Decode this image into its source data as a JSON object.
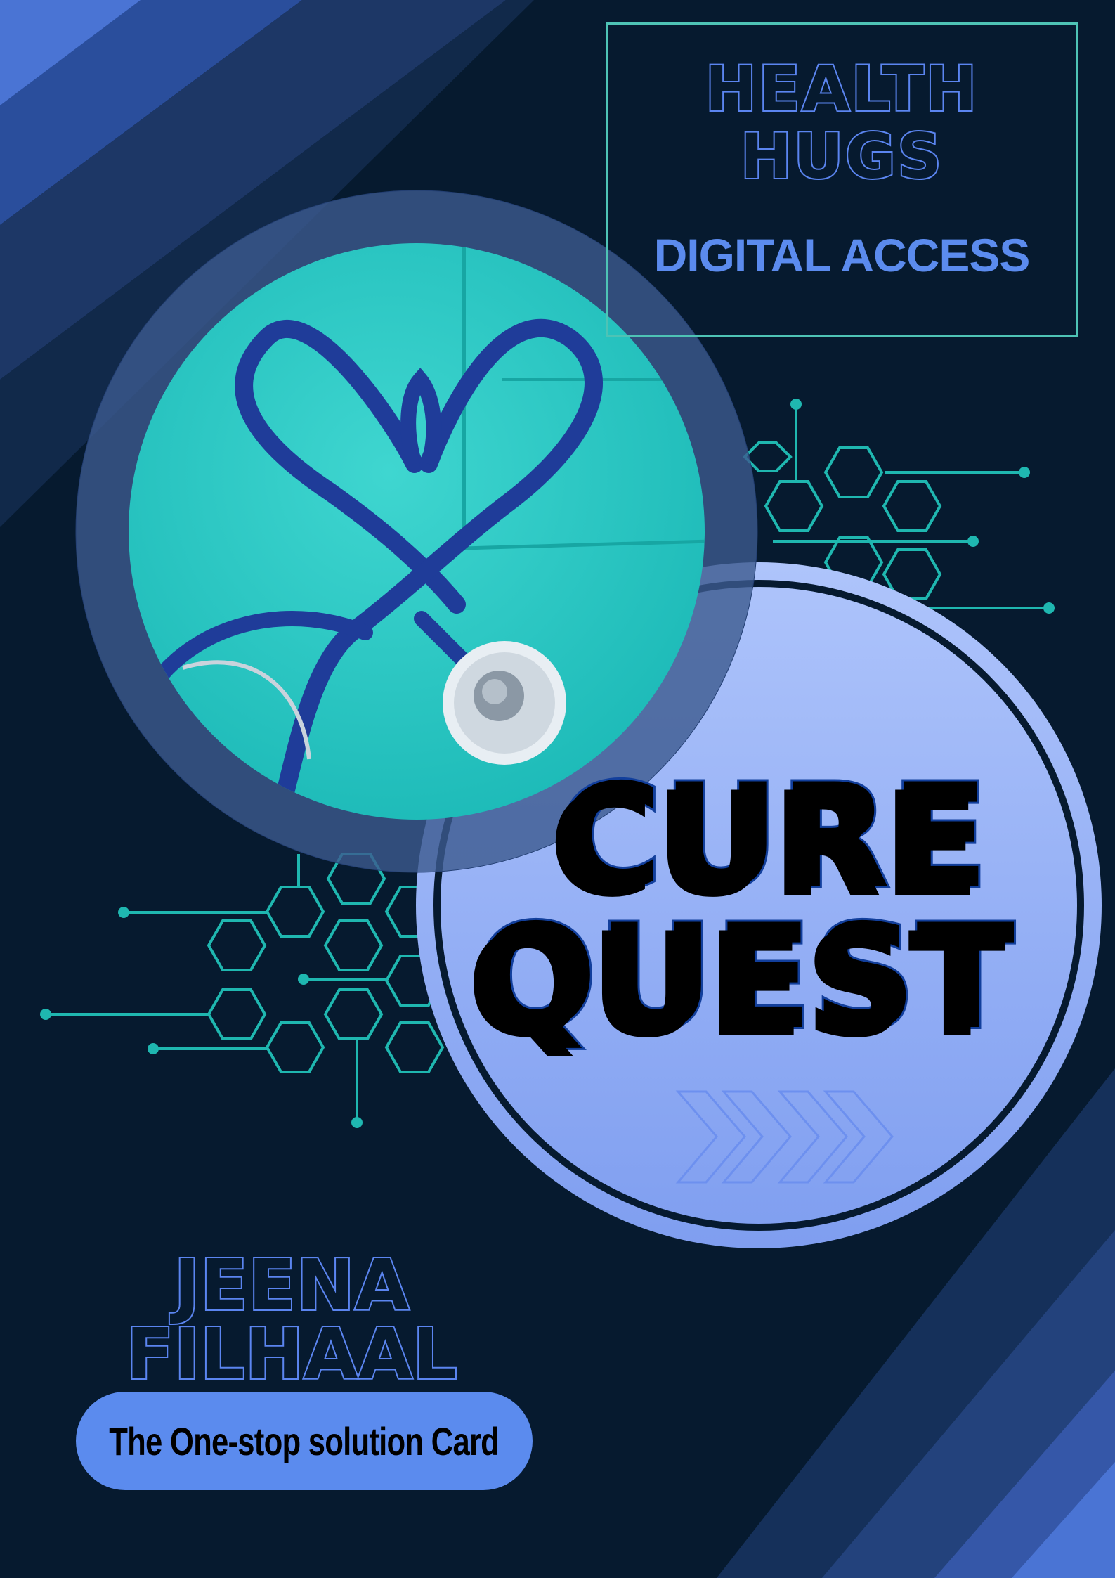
{
  "header": {
    "title_lines": [
      "HEALTH",
      "HUGS"
    ],
    "subtitle": "DIGITAL ACCESS"
  },
  "hero": {
    "title_lines": [
      "CURE",
      "QUEST"
    ],
    "photo_subject": "heart-shaped stethoscope on teal scrubs",
    "chevron_count": 4
  },
  "brand": {
    "name_lines": [
      "JEENA",
      "FILHAAL"
    ],
    "tagline": "The One-stop solution Card"
  },
  "colors": {
    "background": "#061a2f",
    "accent_blue": "#5b8bee",
    "circle_fill": "#99b3f7",
    "teal_lines": "#1fb7b0",
    "stripe_blue": "#2a4a8e"
  },
  "icons": [
    "stethoscope-heart-photo",
    "hexagon-circuit-graphic",
    "chevron-arrows-icon"
  ]
}
